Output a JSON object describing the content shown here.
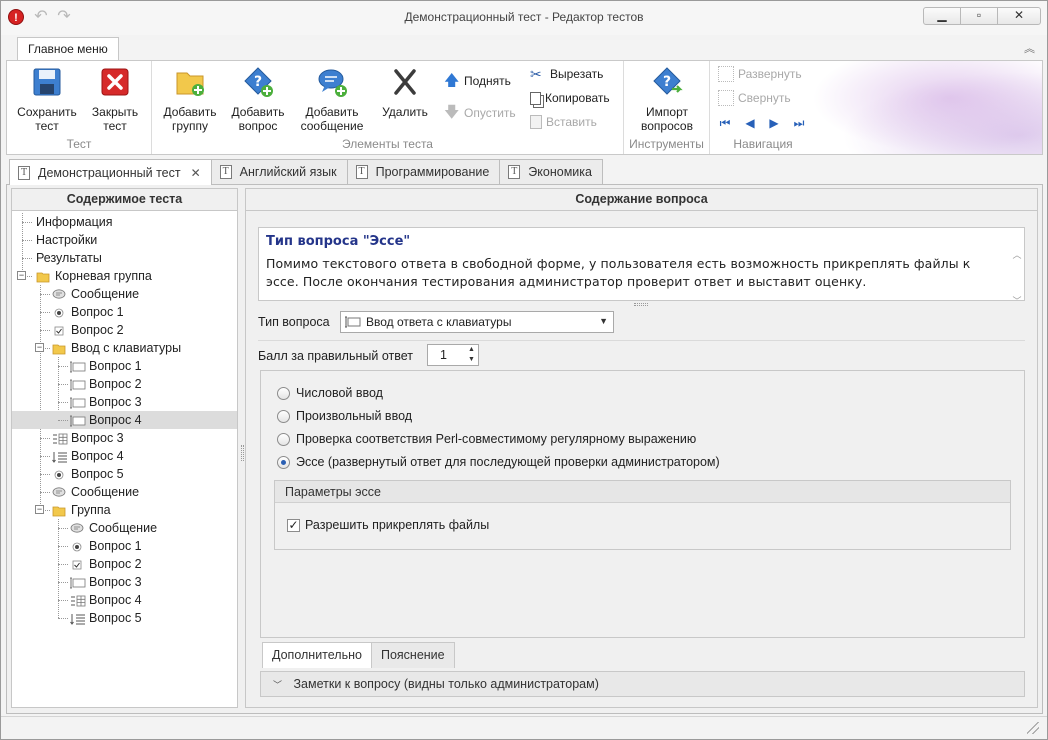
{
  "window": {
    "title": "Демонстрационный тест - Редактор тестов"
  },
  "ribbon": {
    "tab": "Главное меню",
    "groups": {
      "test": {
        "label": "Тест",
        "save": "Сохранить тест",
        "close": "Закрыть тест"
      },
      "elements": {
        "label": "Элементы теста",
        "add_group": "Добавить группу",
        "add_question": "Добавить вопрос",
        "add_message": "Добавить сообщение",
        "delete": "Удалить",
        "move_up": "Поднять",
        "move_down": "Опустить",
        "cut": "Вырезать",
        "copy": "Копировать",
        "paste": "Вставить"
      },
      "tools": {
        "label": "Инструменты",
        "import": "Импорт вопросов"
      },
      "navigation": {
        "label": "Навигация",
        "expand": "Развернуть",
        "collapse": "Свернуть"
      }
    }
  },
  "doc_tabs": [
    {
      "label": "Демонстрационный тест"
    },
    {
      "label": "Английский язык"
    },
    {
      "label": "Программирование"
    },
    {
      "label": "Экономика"
    }
  ],
  "left_panel": {
    "header": "Содержимое теста",
    "tree": [
      {
        "label": "Информация",
        "icon": "none",
        "level": 0
      },
      {
        "label": "Настройки",
        "icon": "none",
        "level": 0
      },
      {
        "label": "Результаты",
        "icon": "none",
        "level": 0
      },
      {
        "label": "Корневая группа",
        "icon": "folder-icon",
        "level": 0
      },
      {
        "label": "Сообщение",
        "icon": "message-icon",
        "level": 1
      },
      {
        "label": "Вопрос 1",
        "icon": "radio-question-icon",
        "level": 1
      },
      {
        "label": "Вопрос 2",
        "icon": "checkbox-question-icon",
        "level": 1
      },
      {
        "label": "Ввод с клавиатуры",
        "icon": "folder-icon",
        "level": 1
      },
      {
        "label": "Вопрос 1",
        "icon": "keyboard-input-icon",
        "level": 2
      },
      {
        "label": "Вопрос 2",
        "icon": "keyboard-input-icon",
        "level": 2
      },
      {
        "label": "Вопрос 3",
        "icon": "keyboard-input-icon",
        "level": 2
      },
      {
        "label": "Вопрос 4",
        "icon": "keyboard-input-icon",
        "level": 2
      },
      {
        "label": "Вопрос 3",
        "icon": "matching-question-icon",
        "level": 1
      },
      {
        "label": "Вопрос 4",
        "icon": "ordering-question-icon",
        "level": 1
      },
      {
        "label": "Вопрос 5",
        "icon": "radio-question-icon",
        "level": 1
      },
      {
        "label": "Сообщение",
        "icon": "message-icon",
        "level": 1
      },
      {
        "label": "Группа",
        "icon": "folder-icon",
        "level": 1
      },
      {
        "label": "Сообщение",
        "icon": "message-icon",
        "level": 2
      },
      {
        "label": "Вопрос 1",
        "icon": "radio-question-icon",
        "level": 2
      },
      {
        "label": "Вопрос 2",
        "icon": "checkbox-question-icon",
        "level": 2
      },
      {
        "label": "Вопрос 3",
        "icon": "keyboard-input-icon",
        "level": 2
      },
      {
        "label": "Вопрос 4",
        "icon": "matching-question-icon",
        "level": 2
      },
      {
        "label": "Вопрос 5",
        "icon": "ordering-question-icon",
        "level": 2
      }
    ]
  },
  "right_panel": {
    "header": "Содержание вопроса",
    "description_title": "Тип вопроса \"Эссе\"",
    "description_text": "Помимо текстового ответа в свободной форме, у пользователя есть возможность прикреплять файлы к эссе. После окончания тестирования администратор проверит ответ и выставит оценку.",
    "question_type_label": "Тип вопроса",
    "question_type_value": "Ввод ответа с клавиатуры",
    "score_label": "Балл за правильный ответ",
    "score_value": "1",
    "options": [
      {
        "label": "Числовой ввод",
        "selected": false
      },
      {
        "label": "Произвольный ввод",
        "selected": false
      },
      {
        "label": "Проверка соответствия Perl-совместимому регулярному выражению",
        "selected": false
      },
      {
        "label": "Эссе (развернутый ответ для последующей проверки администратором)",
        "selected": true
      }
    ],
    "essay_params_header": "Параметры эссе",
    "allow_files_label": "Разрешить прикреплять файлы",
    "allow_files_checked": true,
    "bottom_tabs": [
      {
        "label": "Дополнительно"
      },
      {
        "label": "Пояснение"
      }
    ],
    "notes_label": "Заметки к вопросу (видны только администраторам)"
  },
  "colors": {
    "accent": "#2b5fb3",
    "title_blue": "#24358a",
    "close_red": "#d62222"
  }
}
